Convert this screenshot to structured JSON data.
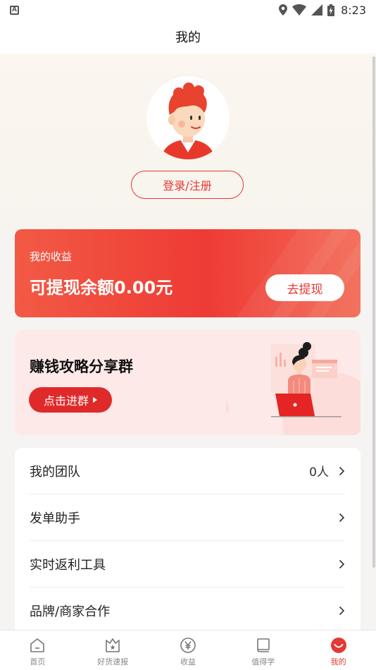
{
  "status_bar": {
    "time": "8:23",
    "left_icon_letter": "A",
    "icons": [
      "location-icon",
      "wifi-icon",
      "signal-icon",
      "battery-icon"
    ]
  },
  "nav": {
    "title": "我的"
  },
  "profile": {
    "login_label": "登录/注册"
  },
  "income": {
    "label": "我的收益",
    "amount_text": "可提现余额0.00元",
    "withdraw_label": "去提现"
  },
  "group_banner": {
    "title": "赚钱攻略分享群",
    "join_label": "点击进群"
  },
  "menu": {
    "items": [
      {
        "label": "我的团队",
        "value": "0人"
      },
      {
        "label": "发单助手"
      },
      {
        "label": "实时返利工具"
      },
      {
        "label": "品牌/商家合作"
      }
    ]
  },
  "tabs": [
    {
      "label": "首页",
      "icon": "home-icon"
    },
    {
      "label": "好货速报",
      "icon": "crown-box-icon"
    },
    {
      "label": "收益",
      "icon": "yen-icon"
    },
    {
      "label": "值得学",
      "icon": "book-icon"
    },
    {
      "label": "我的",
      "icon": "smile-icon",
      "active": true
    }
  ],
  "colors": {
    "accent": "#e53935",
    "card_gradient_start": "#f25a45",
    "card_gradient_end": "#ee3b35",
    "banner_bg": "#fde9e7"
  }
}
